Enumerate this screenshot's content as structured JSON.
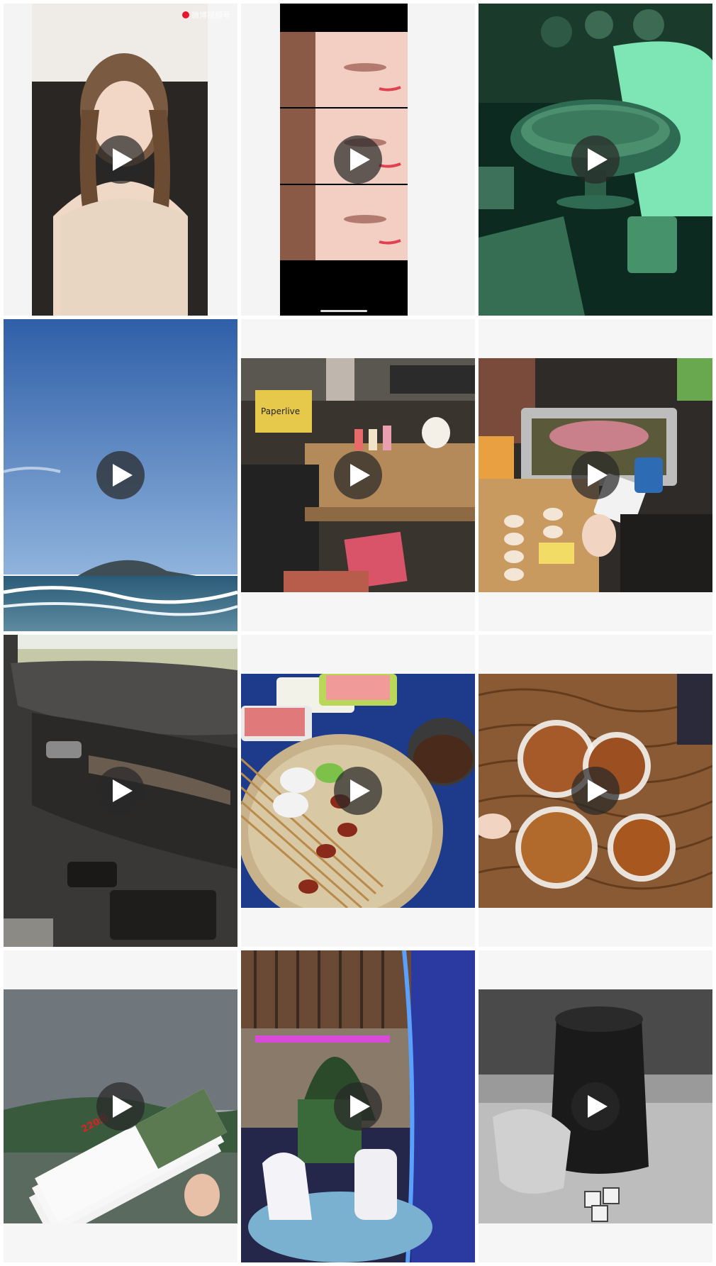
{
  "grid": {
    "tiles": [
      {
        "id": "video-1",
        "watermark": "微博视频号"
      },
      {
        "id": "video-2"
      },
      {
        "id": "video-3"
      },
      {
        "id": "video-4"
      },
      {
        "id": "video-5",
        "sign_text": "Paperlive"
      },
      {
        "id": "video-6"
      },
      {
        "id": "video-7"
      },
      {
        "id": "video-8"
      },
      {
        "id": "video-9"
      },
      {
        "id": "video-10",
        "ticket_price": "220元"
      },
      {
        "id": "video-11"
      },
      {
        "id": "video-12"
      }
    ]
  },
  "icons": {
    "play": "play-icon",
    "weibo": "weibo-logo-icon"
  },
  "colors": {
    "tile_background": "#f6f6f6",
    "play_button_bg": "#282828",
    "play_glyph": "#ffffff"
  }
}
